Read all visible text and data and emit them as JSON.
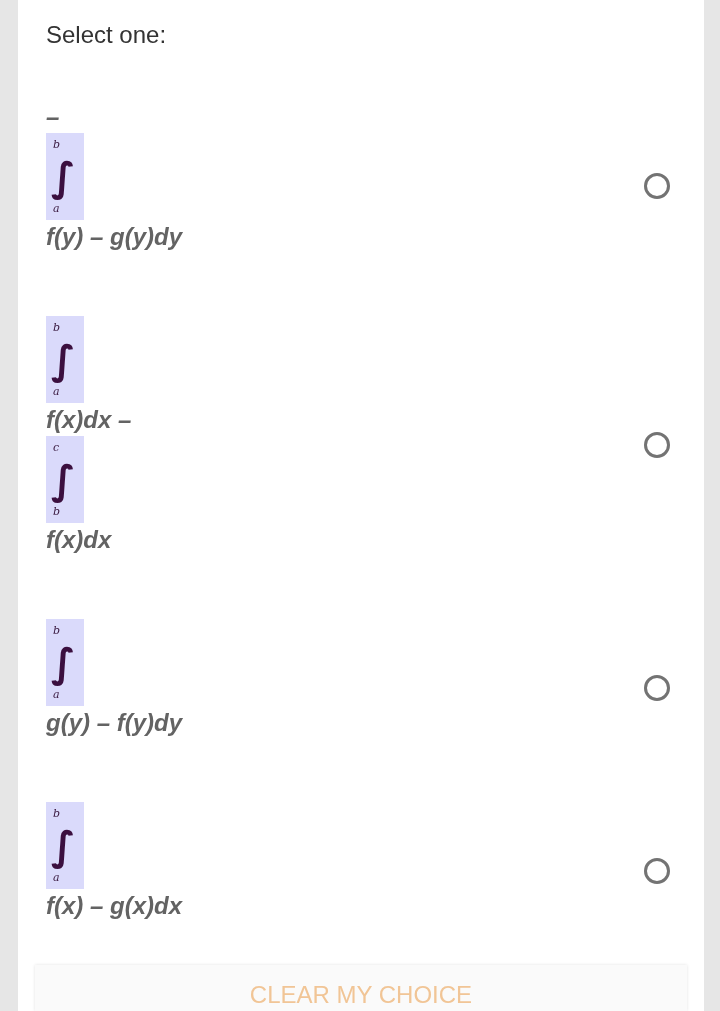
{
  "prompt": "Select one:",
  "options": [
    {
      "selected": false,
      "parts": [
        {
          "kind": "text",
          "text": "–"
        },
        {
          "kind": "integral",
          "symbol": "∫",
          "upper": "b",
          "lower": "a"
        },
        {
          "kind": "text",
          "text": "f(y) – g(y)dy"
        }
      ]
    },
    {
      "selected": false,
      "parts": [
        {
          "kind": "integral",
          "symbol": "∫",
          "upper": "b",
          "lower": "a"
        },
        {
          "kind": "text",
          "text": "f(x)dx –"
        },
        {
          "kind": "integral",
          "symbol": "∫",
          "upper": "c",
          "lower": "b"
        },
        {
          "kind": "text",
          "text": "f(x)dx"
        }
      ]
    },
    {
      "selected": false,
      "parts": [
        {
          "kind": "integral",
          "symbol": "∫",
          "upper": "b",
          "lower": "a"
        },
        {
          "kind": "text",
          "text": "g(y) – f(y)dy"
        }
      ]
    },
    {
      "selected": false,
      "parts": [
        {
          "kind": "integral",
          "symbol": "∫",
          "upper": "b",
          "lower": "a"
        },
        {
          "kind": "text",
          "text": "f(x) – g(x)dx"
        }
      ]
    }
  ],
  "clear_button": "CLEAR MY CHOICE"
}
